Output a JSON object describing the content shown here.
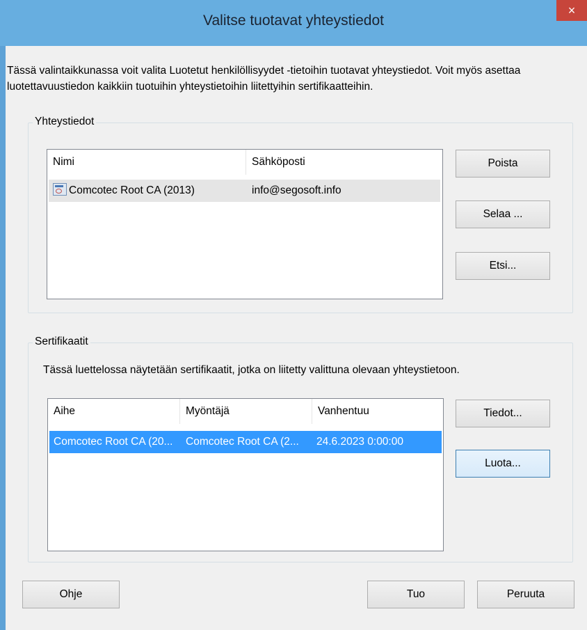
{
  "window": {
    "title": "Valitse tuotavat yhteystiedot",
    "close_glyph": "×"
  },
  "description": "Tässä valintaikkunassa voit valita Luotetut henkilöllisyydet -tietoihin tuotavat yhteystiedot. Voit myös asettaa luotettavuustiedon kaikkiin tuotuihin yhteystietoihin liitettyihin sertifikaatteihin.",
  "contacts": {
    "group_label": "Yhteystiedot",
    "columns": [
      "Nimi",
      "Sähköposti"
    ],
    "rows": [
      {
        "name": "Comcotec Root CA (2013)",
        "email": "info@segosoft.info",
        "icon": "certificate-icon"
      }
    ],
    "buttons": {
      "remove": "Poista",
      "browse": "Selaa ...",
      "search": "Etsi..."
    }
  },
  "certificates": {
    "group_label": "Sertifikaatit",
    "description": "Tässä luettelossa näytetään sertifikaatit, jotka on liitetty valittuna olevaan yhteystietoon.",
    "columns": [
      "Aihe",
      "Myöntäjä",
      "Vanhentuu"
    ],
    "rows": [
      {
        "subject": "Comcotec Root CA (20...",
        "issuer": "Comcotec Root CA (2...",
        "expires": "24.6.2023 0:00:00"
      }
    ],
    "buttons": {
      "details": "Tiedot...",
      "trust": "Luota..."
    }
  },
  "footer": {
    "help": "Ohje",
    "import": "Tuo",
    "cancel": "Peruuta"
  },
  "colors": {
    "titlebar": "#67aee0",
    "close": "#c7453b",
    "selection": "#3399ff"
  }
}
